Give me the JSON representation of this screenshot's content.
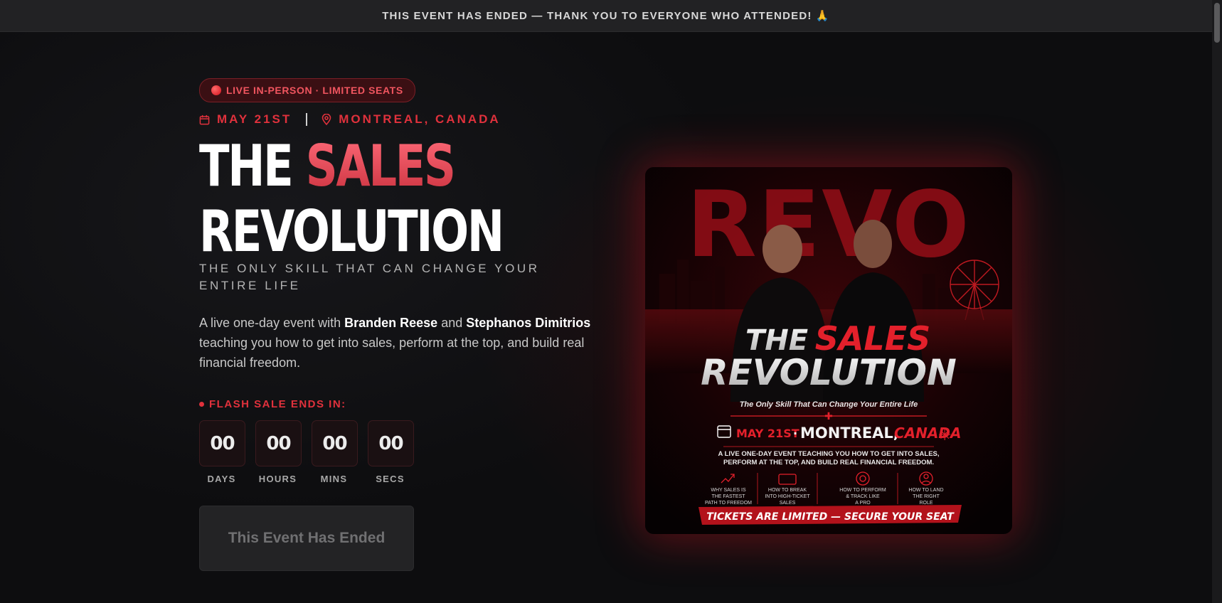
{
  "banner": {
    "text": "THIS EVENT HAS ENDED — THANK YOU TO EVERYONE WHO ATTENDED! 🙏"
  },
  "hero": {
    "badge": "LIVE IN-PERSON · LIMITED SEATS",
    "date": "MAY 21ST",
    "location": "MONTREAL, CANADA",
    "title_part1": "THE ",
    "title_accent": "SALES",
    "title_part2": "REVOLUTION",
    "tagline": "THE ONLY SKILL THAT CAN CHANGE YOUR ENTIRE LIFE",
    "description": {
      "prefix": "A live one-day event with ",
      "host1": "Branden Reese",
      "joiner": " and ",
      "host2": "Stephanos Dimitrios",
      "suffix": " teaching you how to get into sales, perform at the top, and build real financial freedom."
    },
    "flash_label": "FLASH SALE ENDS IN:",
    "countdown": [
      {
        "value": "00",
        "label": "DAYS"
      },
      {
        "value": "00",
        "label": "HOURS"
      },
      {
        "value": "00",
        "label": "MINS"
      },
      {
        "value": "00",
        "label": "SECS"
      }
    ],
    "cta_label": "This Event Has Ended"
  },
  "poster": {
    "backdrop_word": "REVO",
    "title_line1_a": "THE",
    "title_line1_b": "SALES",
    "title_line2": "REVOLUTION",
    "subtitle": "The Only Skill That Can Change Your Entire Life",
    "date": "MAY 21ST",
    "dot": "·",
    "city": "MONTREAL,",
    "country": "CANADA",
    "blurb_line1": "A LIVE ONE-DAY EVENT TEACHING YOU HOW TO GET INTO SALES,",
    "blurb_line2": "PERFORM AT THE TOP, AND BUILD REAL FINANCIAL FREEDOM.",
    "features": [
      {
        "l1": "WHY SALES IS",
        "l2": "THE FASTEST",
        "l3": "PATH TO FREEDOM"
      },
      {
        "l1": "HOW TO BREAK",
        "l2": "INTO HIGH-TICKET",
        "l3": "SALES"
      },
      {
        "l1": "HOW TO PERFORM",
        "l2": "& TRACK LIKE",
        "l3": "A PRO"
      },
      {
        "l1": "HOW TO LAND",
        "l2": "THE RIGHT",
        "l3": "ROLE"
      }
    ],
    "footer": "TICKETS ARE LIMITED — SECURE YOUR SEAT"
  },
  "colors": {
    "accent": "#e0313c",
    "accent_light": "#ff6b79",
    "background": "#0d0d0f"
  }
}
